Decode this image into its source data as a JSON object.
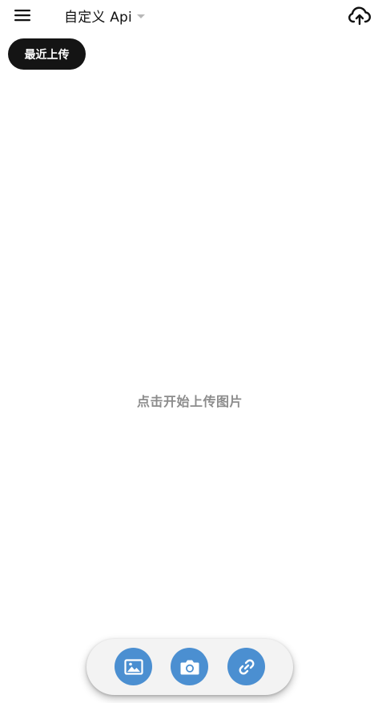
{
  "app_bar": {
    "menu_icon": "menu-icon",
    "title": "自定义 Api",
    "dropdown_icon": "arrow-drop-down-icon",
    "upload_icon": "cloud-upload-icon"
  },
  "recent_uploads": {
    "label": "最近上传"
  },
  "main": {
    "empty_hint": "点击开始上传图片"
  },
  "actions": [
    {
      "name": "gallery",
      "icon": "image-icon"
    },
    {
      "name": "camera",
      "icon": "camera-icon"
    },
    {
      "name": "link",
      "icon": "link-icon"
    }
  ],
  "colors": {
    "accent": "#4b8fd1",
    "chip_background": "#141414",
    "hint_text": "#8c8c8c",
    "action_bar_background": "#f3f3f3"
  }
}
